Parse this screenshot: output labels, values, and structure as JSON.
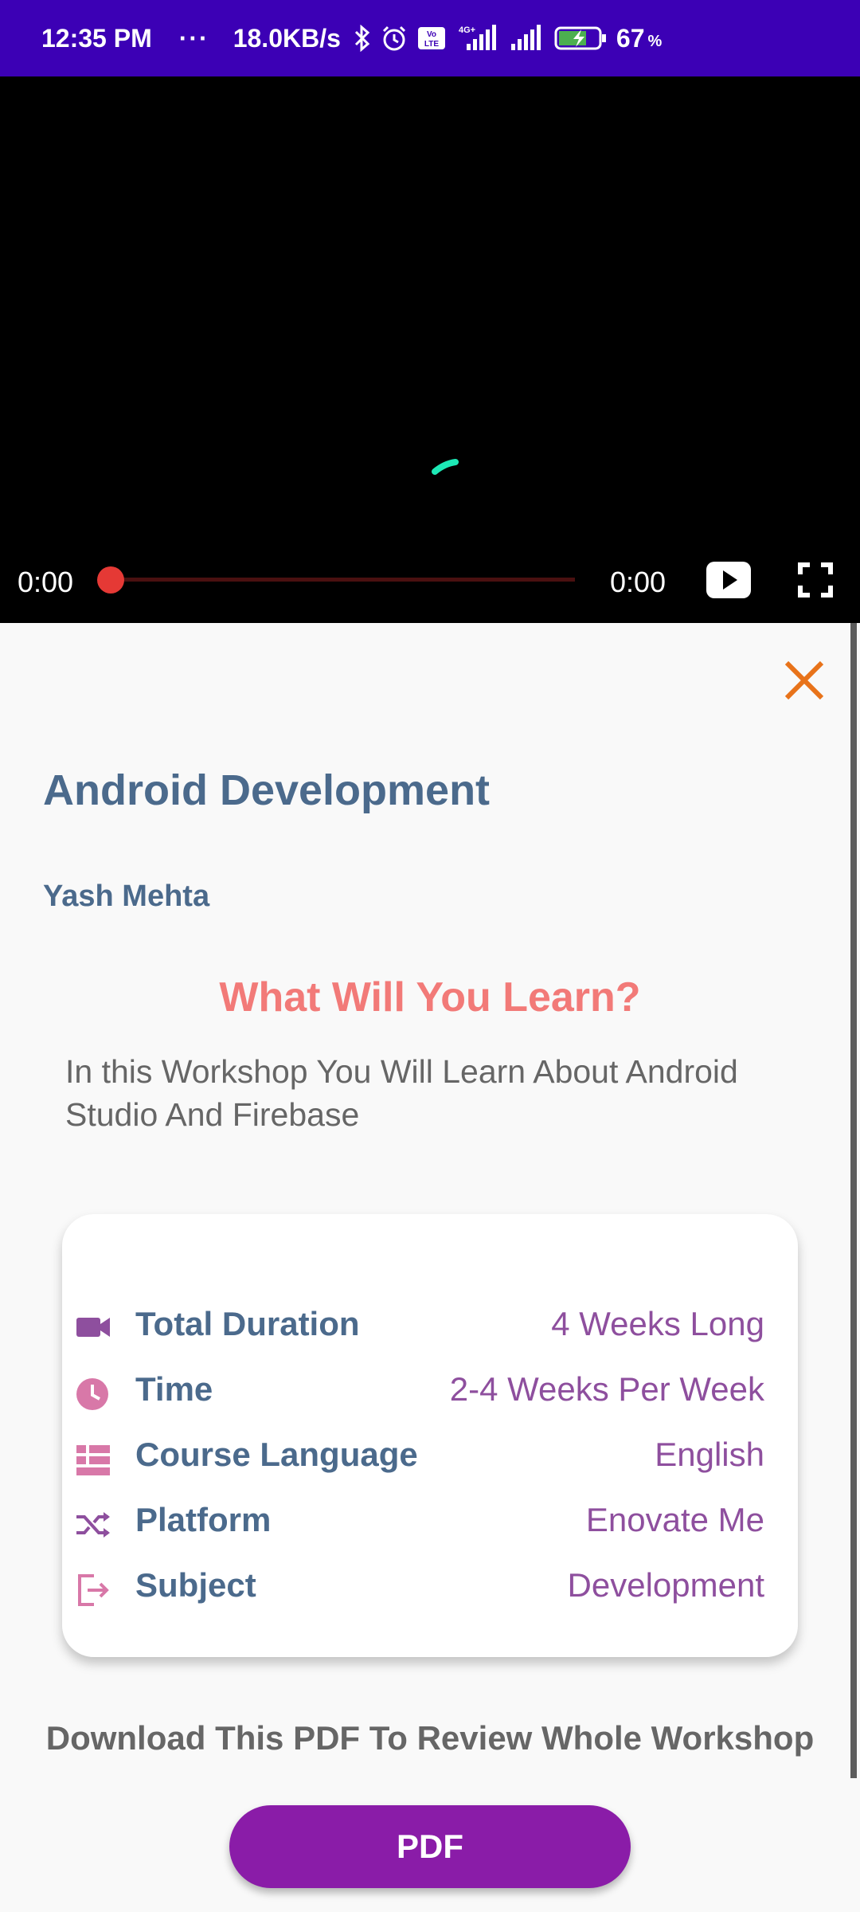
{
  "status_bar": {
    "time": "12:35 PM",
    "dots": "···",
    "net_speed": "18.0KB/s",
    "battery_percent": "67",
    "battery_unit": "%",
    "volte_label": "Vo LTE",
    "network_label": "4G+"
  },
  "player": {
    "current_time": "0:00",
    "total_time": "0:00",
    "progress": 0
  },
  "course": {
    "title": "Android Development",
    "author": "Yash Mehta"
  },
  "learn": {
    "heading": "What Will You Learn?",
    "description": "In this Workshop You Will Learn About Android Studio And Firebase"
  },
  "details": [
    {
      "icon": "video-camera-icon",
      "label": "Total Duration",
      "value": "4 Weeks Long"
    },
    {
      "icon": "clock-icon",
      "label": "Time",
      "value": "2-4 Weeks Per Week"
    },
    {
      "icon": "list-icon",
      "label": "Course Language",
      "value": "English"
    },
    {
      "icon": "shuffle-icon",
      "label": "Platform",
      "value": "Enovate Me"
    },
    {
      "icon": "logout-icon",
      "label": "Subject",
      "value": "Development"
    }
  ],
  "download": {
    "text": "Download This PDF To Review Whole Workshop",
    "button_label": "PDF"
  },
  "colors": {
    "status_bar": "#3c00b5",
    "accent_close": "#e8731a",
    "heading": "#4b6a8c",
    "section_title": "#f27a78",
    "value_text": "#8e4f9e",
    "pdf_button": "#8a1ca8",
    "seek_thumb": "#e53935",
    "spinner": "#1de9b6"
  }
}
